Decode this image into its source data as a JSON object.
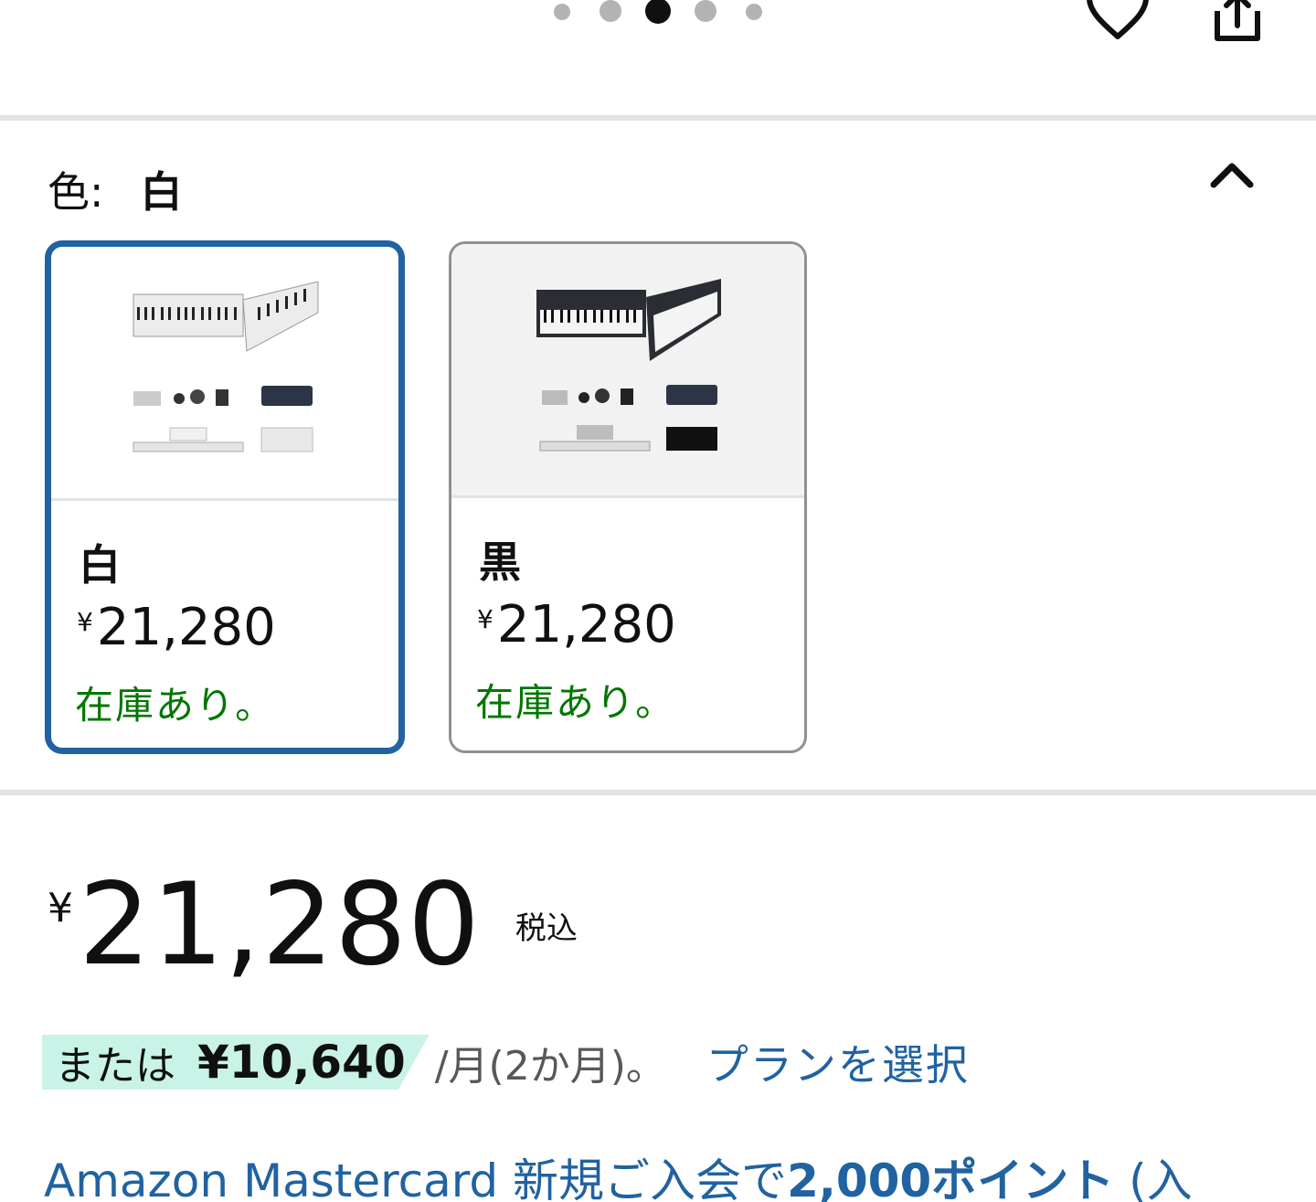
{
  "carousel": {
    "dot_count": 5,
    "active_index": 2
  },
  "header_icons": {
    "wishlist": "heart-outline-icon",
    "share": "share-icon"
  },
  "color_selector": {
    "label": "色:",
    "selected_value": "白",
    "collapse_icon": "chevron-up-icon",
    "options": [
      {
        "name": "白",
        "yen": "¥",
        "price": "21,280",
        "stock": "在庫あり。",
        "selected": true
      },
      {
        "name": "黒",
        "yen": "¥",
        "price": "21,280",
        "stock": "在庫あり。",
        "selected": false
      }
    ]
  },
  "price": {
    "yen": "¥",
    "amount": "21,280",
    "tax_note": "税込"
  },
  "installment": {
    "or_label": "または",
    "monthly_amount": "¥10,640",
    "terms": "/月(2か月)。",
    "plan_link": "プランを選択"
  },
  "card_promo": {
    "text_before": "Amazon Mastercard 新規ご入会で",
    "points": "2,000ポイント",
    "text_after": " (入"
  },
  "colors": {
    "selected_border": "#2162a1",
    "in_stock_green": "#007600",
    "link_blue": "#2162a1",
    "installment_badge_bg": "#c8f3e6",
    "divider": "#dfe3e3"
  }
}
